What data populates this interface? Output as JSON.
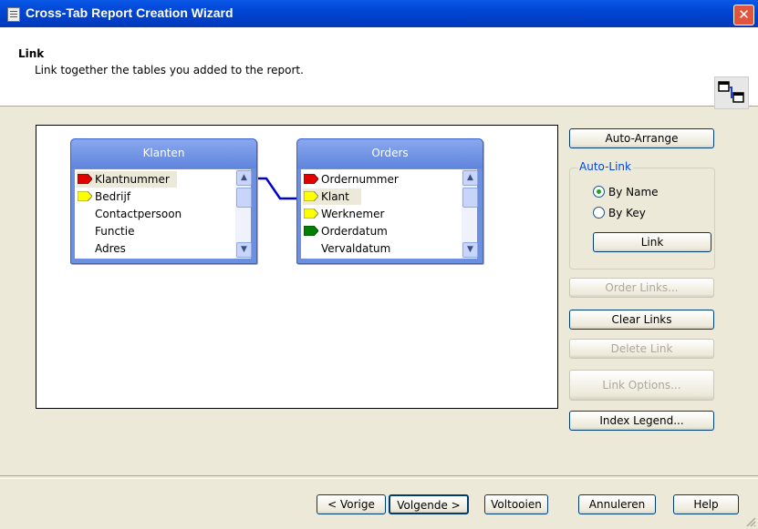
{
  "window": {
    "title": "Cross-Tab Report Creation Wizard",
    "close_glyph": "✕"
  },
  "header": {
    "heading": "Link",
    "description": "Link together the tables you added to the report."
  },
  "tables": [
    {
      "name": "Klanten",
      "fields": [
        {
          "label": "Klantnummer",
          "key": "red",
          "selected": true
        },
        {
          "label": "Bedrijf",
          "key": "yellow"
        },
        {
          "label": "Contactpersoon",
          "key": "none"
        },
        {
          "label": "Functie",
          "key": "none"
        },
        {
          "label": "Adres",
          "key": "none"
        }
      ]
    },
    {
      "name": "Orders",
      "fields": [
        {
          "label": "Ordernummer",
          "key": "red"
        },
        {
          "label": "Klant",
          "key": "yellow",
          "selected": true
        },
        {
          "label": "Werknemer",
          "key": "yellow"
        },
        {
          "label": "Orderdatum",
          "key": "green"
        },
        {
          "label": "Vervaldatum",
          "key": "none"
        }
      ]
    }
  ],
  "right_panel": {
    "auto_arrange": "Auto-Arrange",
    "auto_link_group": "Auto-Link",
    "by_name": "By Name",
    "by_key": "By Key",
    "selected_option": "By Name",
    "link": "Link",
    "order_links": "Order Links...",
    "clear_links": "Clear Links",
    "delete_link": "Delete Link",
    "link_options": "Link Options...",
    "index_legend": "Index Legend..."
  },
  "footer": {
    "back": "< Vorige",
    "next": "Volgende >",
    "finish": "Voltooien",
    "cancel": "Annuleren",
    "help": "Help"
  },
  "colors": {
    "key_red": "#e00000",
    "key_yellow": "#ffff00",
    "key_green": "#008000",
    "link_line": "#0000cc"
  }
}
